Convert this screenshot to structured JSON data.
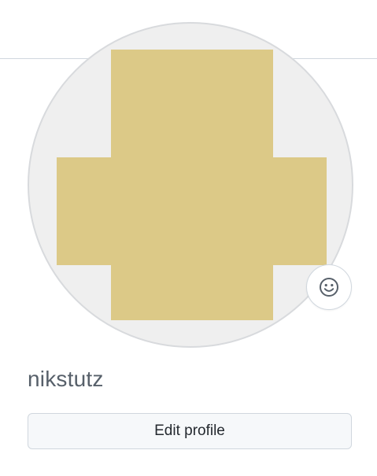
{
  "profile": {
    "username": "nikstutz",
    "edit_label": "Edit profile",
    "avatar_color": "#dcc987",
    "avatar_background": "#efefef",
    "status_icon": "smiley-icon"
  }
}
